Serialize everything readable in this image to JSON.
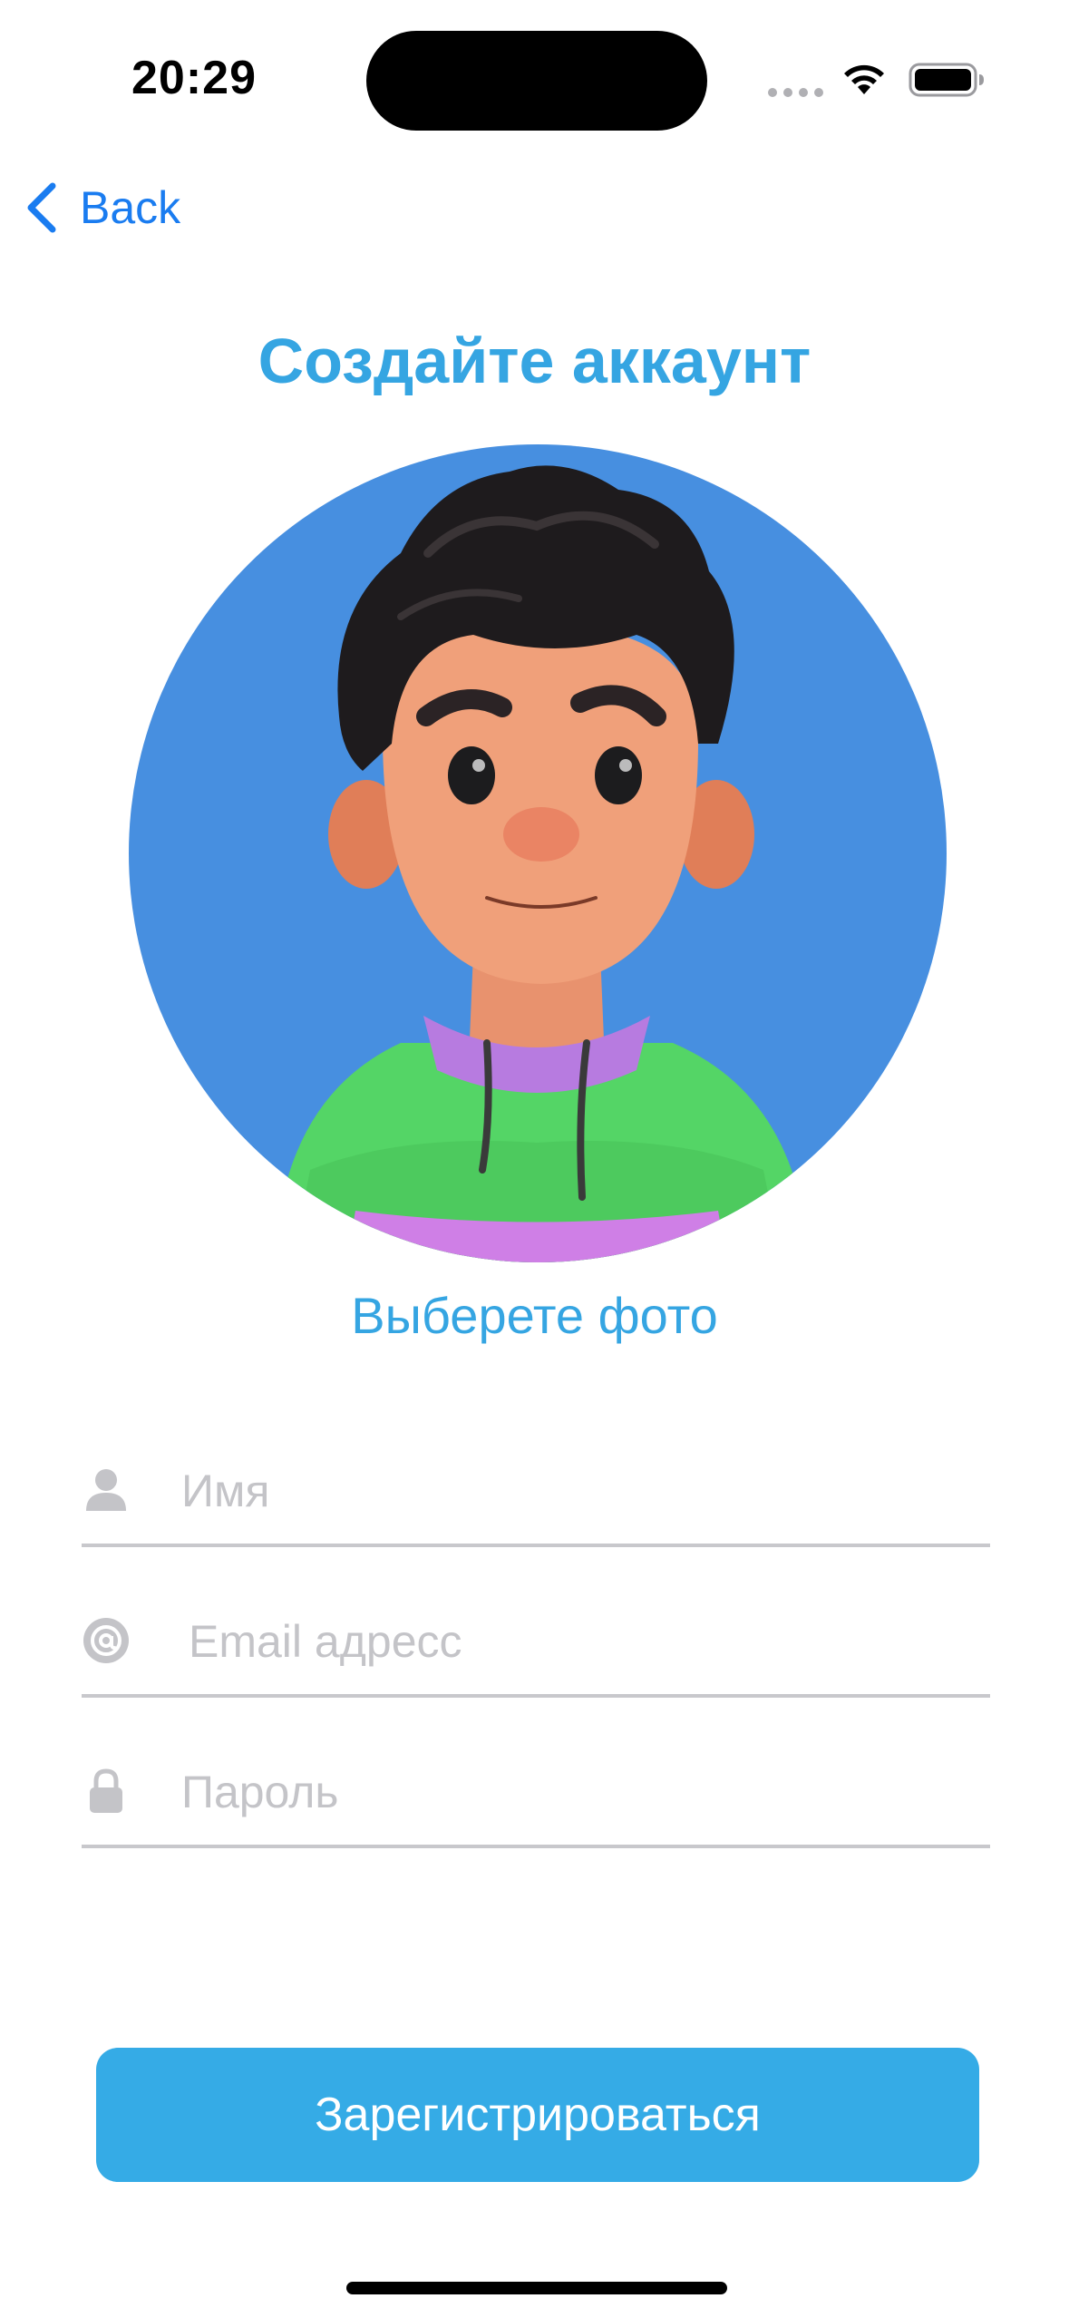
{
  "status_bar": {
    "time": "20:29"
  },
  "nav": {
    "back_label": "Back"
  },
  "header": {
    "title": "Создайте аккаунт"
  },
  "avatar": {
    "choose_photo_label": "Выберете фото",
    "background_color": "#478fe0"
  },
  "form": {
    "name": {
      "placeholder": "Имя",
      "value": "",
      "icon": "person-icon"
    },
    "email": {
      "placeholder": "Email адресс",
      "value": "",
      "icon": "at-icon"
    },
    "password": {
      "placeholder": "Пароль",
      "value": "",
      "icon": "lock-icon"
    }
  },
  "actions": {
    "register_label": "Зарегистрироваться"
  },
  "colors": {
    "accent": "#35a5e2",
    "button": "#35abe6",
    "link": "#1a7cf0",
    "placeholder": "#c4c4c8"
  }
}
